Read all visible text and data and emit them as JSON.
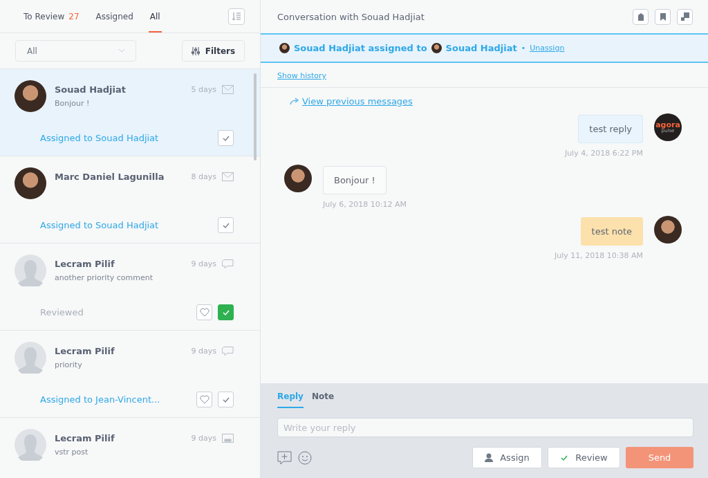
{
  "tabs": [
    {
      "label": "To Review",
      "count": "27",
      "selected": false
    },
    {
      "label": "Assigned",
      "selected": false
    },
    {
      "label": "All",
      "selected": true
    }
  ],
  "filter": {
    "value": "All",
    "button": "Filters"
  },
  "conversations": [
    {
      "name": "Souad Hadjiat",
      "preview": "Bonjour !",
      "time": "5 days",
      "kind": "mail",
      "photo": true,
      "status": "Assigned to Souad Hadjiat",
      "heart": false,
      "reviewed": false,
      "selected": true
    },
    {
      "name": "Marc Daniel Lagunilla",
      "time": "8 days",
      "kind": "mail",
      "photo": true,
      "status": "Assigned to Souad Hadjiat",
      "heart": false,
      "reviewed": false,
      "selected": false
    },
    {
      "name": "Lecram Pilif",
      "preview": "another priority comment",
      "time": "9 days",
      "kind": "comment",
      "photo": false,
      "status": "Reviewed",
      "heart": true,
      "reviewed": true,
      "selected": false
    },
    {
      "name": "Lecram Pilif",
      "preview": "priority",
      "time": "9 days",
      "kind": "comment",
      "photo": false,
      "status": "Assigned to Jean-Vincent...",
      "heart": true,
      "reviewed": false,
      "selected": false
    },
    {
      "name": "Lecram Pilif",
      "preview": "vstr post",
      "time": "9 days",
      "kind": "post",
      "photo": false,
      "selected": false
    }
  ],
  "conversation": {
    "title": "Conversation with Souad Hadjiat",
    "assignment": {
      "from": "Souad Hadjiat assigned to",
      "to": "Souad Hadjiat",
      "separator": "•",
      "link": "Unassign"
    },
    "history_link": "Show history",
    "previous_link": "View previous messages",
    "messages": [
      {
        "kind": "reply",
        "text": "test reply",
        "time": "July 4, 2018 6:22 PM",
        "logo_top": "agora",
        "logo_bottom": "pulse"
      },
      {
        "kind": "incoming",
        "text": "Bonjour !",
        "time": "July 6, 2018 10:12 AM"
      },
      {
        "kind": "note",
        "text": "test note",
        "time": "July 11, 2018 10:38 AM"
      }
    ]
  },
  "composer": {
    "tabs": [
      {
        "label": "Reply",
        "selected": true
      },
      {
        "label": "Note",
        "selected": false
      }
    ],
    "placeholder": "Write your reply",
    "assign": "Assign",
    "review": "Review",
    "send": "Send"
  }
}
